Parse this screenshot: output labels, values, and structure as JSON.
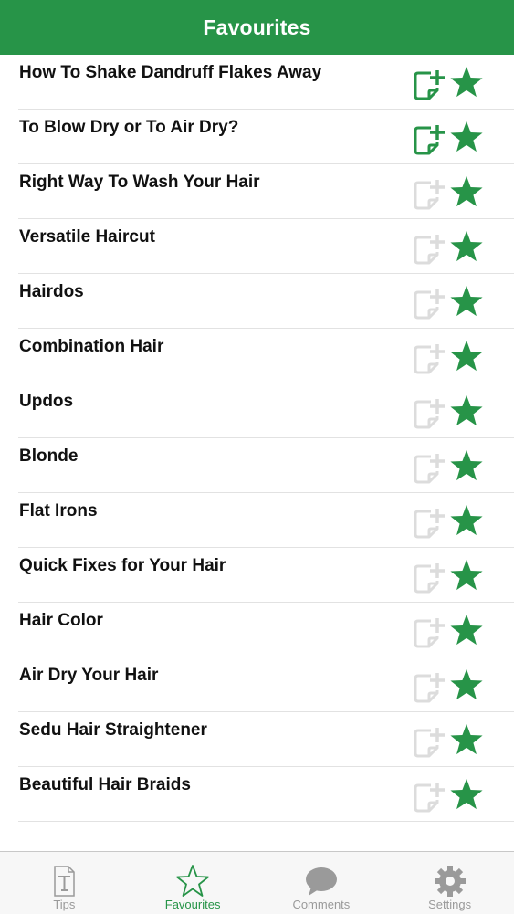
{
  "header": {
    "title": "Favourites"
  },
  "colors": {
    "accent": "#279448",
    "note_active": "#279448",
    "note_inactive": "#dcdcdc",
    "tab_inactive": "#9a9a9a"
  },
  "favourites": [
    {
      "title": "How To Shake Dandruff Flakes Away",
      "note_active": true
    },
    {
      "title": "To Blow Dry or To Air Dry?",
      "note_active": true
    },
    {
      "title": "Right Way To Wash Your Hair",
      "note_active": false
    },
    {
      "title": "Versatile Haircut",
      "note_active": false
    },
    {
      "title": "Hairdos",
      "note_active": false
    },
    {
      "title": "Combination Hair",
      "note_active": false
    },
    {
      "title": "Updos",
      "note_active": false
    },
    {
      "title": "Blonde",
      "note_active": false
    },
    {
      "title": "Flat Irons",
      "note_active": false
    },
    {
      "title": "Quick Fixes for Your Hair",
      "note_active": false
    },
    {
      "title": "Hair Color",
      "note_active": false
    },
    {
      "title": "Air Dry Your Hair",
      "note_active": false
    },
    {
      "title": "Sedu Hair Straightener",
      "note_active": false
    },
    {
      "title": "Beautiful Hair Braids",
      "note_active": false
    }
  ],
  "tabs": [
    {
      "label": "Tips",
      "icon": "tips-icon",
      "active": false
    },
    {
      "label": "Favourites",
      "icon": "star-outline-icon",
      "active": true
    },
    {
      "label": "Comments",
      "icon": "speech-bubble-icon",
      "active": false
    },
    {
      "label": "Settings",
      "icon": "gear-icon",
      "active": false
    }
  ]
}
